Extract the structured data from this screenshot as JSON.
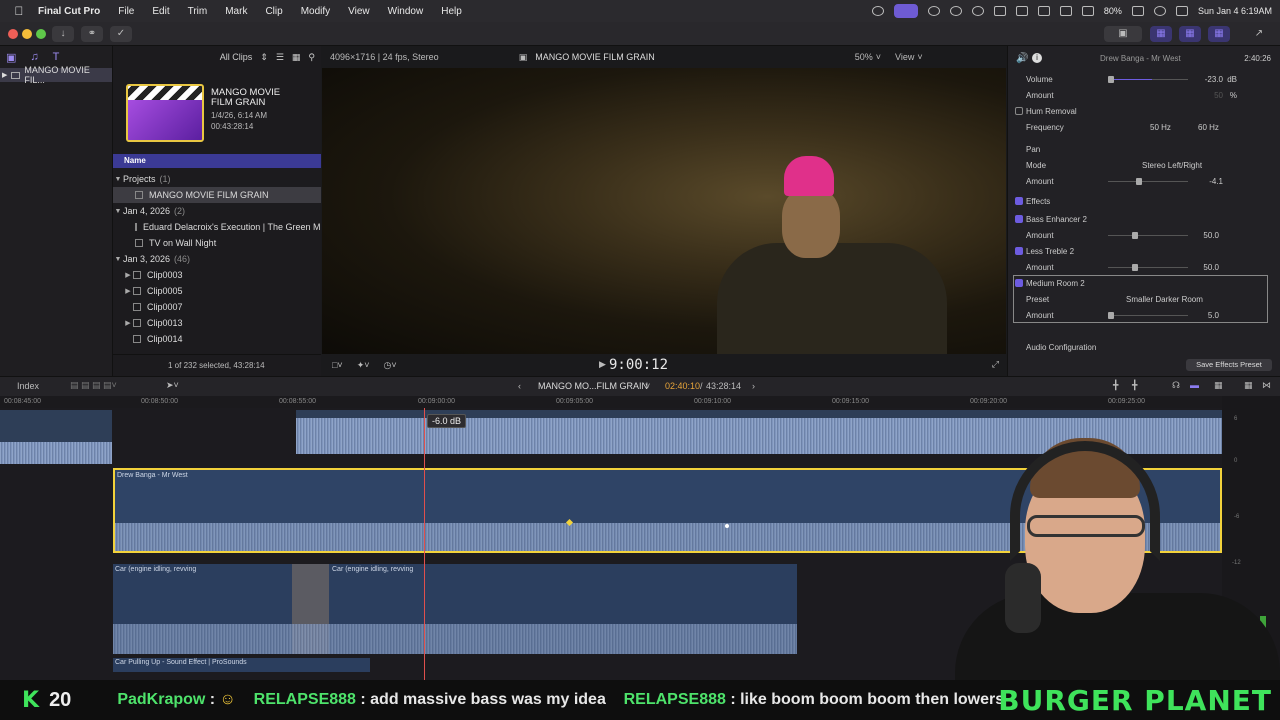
{
  "menubar": {
    "app_name": "Final Cut Pro",
    "items": [
      "File",
      "Edit",
      "Trim",
      "Mark",
      "Clip",
      "Modify",
      "View",
      "Window",
      "Help"
    ],
    "battery": "80%",
    "clock": "Sun Jan 4  6:19AM"
  },
  "sidebar": {
    "library_name": "MANGO MOVIE FIL..."
  },
  "browser": {
    "filter_label": "All Clips",
    "project": {
      "title_line1": "MANGO MOVIE",
      "title_line2": "FILM GRAIN",
      "date": "1/4/26, 6:14 AM",
      "duration": "00:43:28:14"
    },
    "column_header": "Name",
    "rows": [
      {
        "label": "Projects",
        "count": "(1)"
      },
      {
        "label": "MANGO MOVIE FILM GRAIN"
      },
      {
        "label": "Jan 4, 2026",
        "count": "(2)"
      },
      {
        "label": "Eduard Delacroix's Execution  |  The Green Mile"
      },
      {
        "label": "TV on Wall Night"
      },
      {
        "label": "Jan 3, 2026",
        "count": "(46)"
      },
      {
        "label": "Clip0003"
      },
      {
        "label": "Clip0005"
      },
      {
        "label": "Clip0007"
      },
      {
        "label": "Clip0013"
      },
      {
        "label": "Clip0014"
      }
    ],
    "footer": "1 of 232 selected, 43:28:14"
  },
  "viewer": {
    "format": "4096×1716 | 24 fps, Stereo",
    "title": "MANGO MOVIE FILM GRAIN",
    "zoom": "50%",
    "view_label": "View",
    "timecode": "9:00:12"
  },
  "inspector": {
    "clip_title": "Drew Banga - Mr West",
    "duration": "2:40:26",
    "rows": {
      "volume_label": "Volume",
      "volume_value": "-23.0",
      "volume_unit": "dB",
      "amount1_label": "Amount",
      "amount1_value": "50",
      "amount1_unit": "%",
      "hum_label": "Hum Removal",
      "freq_label": "Frequency",
      "freq_a": "50 Hz",
      "freq_b": "60 Hz",
      "pan_label": "Pan",
      "mode_label": "Mode",
      "mode_value": "Stereo Left/Right",
      "pan_amount_label": "Amount",
      "pan_amount_value": "-4.1",
      "effects_label": "Effects",
      "bass_label": "Bass Enhancer 2",
      "bass_amount_label": "Amount",
      "bass_amount_value": "50.0",
      "treble_label": "Less Treble 2",
      "treble_amount_label": "Amount",
      "treble_amount_value": "50.0",
      "room_label": "Medium Room 2",
      "preset_label": "Preset",
      "preset_value": "Smaller Darker Room",
      "room_amount_label": "Amount",
      "room_amount_value": "5.0",
      "audio_config_label": "Audio Configuration"
    },
    "save_button": "Save Effects Preset"
  },
  "timeline": {
    "index_label": "Index",
    "project_name": "MANGO MO...FILM GRAIN",
    "position": "02:40:10",
    "total": "43:28:14",
    "ruler": [
      "00:08:45:00",
      "00:08:50:00",
      "00:08:55:00",
      "00:09:00:00",
      "00:09:05:00",
      "00:09:10:00",
      "00:09:15:00",
      "00:09:20:00",
      "00:09:25:00"
    ],
    "volume_tooltip": "-6.0 dB",
    "clips": {
      "music": "Drew Banga - Mr West",
      "car1": "Car (engine idling, revving",
      "car2": "Car (engine idling, revving",
      "car3": "Car Pulling Up - Sound Effect  |  ProSounds"
    },
    "meter_labels": [
      "6",
      "0",
      "-6",
      "-12"
    ]
  },
  "stream": {
    "follower_count": "20",
    "chat": [
      {
        "user": "PadKrapow",
        "message": ""
      },
      {
        "user": "RELAPSE888",
        "message": "add massive bass was my idea"
      },
      {
        "user": "RELAPSE888",
        "message": "like boom boom boom then lowers"
      }
    ],
    "brand": "BURGER PLANET"
  }
}
